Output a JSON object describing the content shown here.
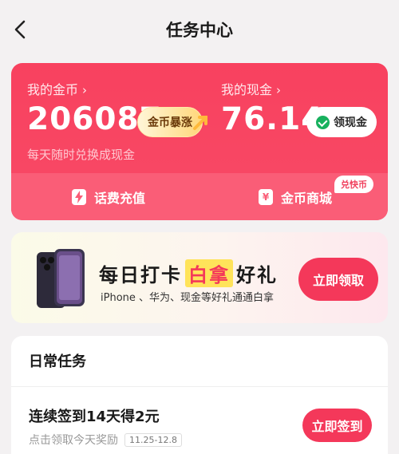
{
  "header": {
    "title": "任务中心"
  },
  "wallet": {
    "coins_label": "我的金币",
    "coins_value": "206087",
    "surge_label": "金币暴涨",
    "cash_label": "我的现金",
    "cash_value": "76.14",
    "claim_cash_label": "领现金",
    "subtitle": "每天随时兑换成现金",
    "phone_topup_label": "话费充值",
    "coin_mall_label": "金币商城",
    "fast_redeem_badge": "兑快币"
  },
  "banner": {
    "title_part1": "每日打卡",
    "title_highlight": "白拿",
    "title_part2": "好礼",
    "subtitle": "iPhone 、华为、现金等好礼通通白拿",
    "button_label": "立即领取"
  },
  "daily_tasks": {
    "section_title": "日常任务",
    "items": [
      {
        "name": "连续签到14天得2元",
        "desc": "点击领取今天奖励",
        "date_range": "11.25-12.8",
        "button_label": "立即签到"
      }
    ]
  },
  "colors": {
    "accent": "#f4385a",
    "wallet_bg": "#f7415f",
    "page_bg": "#f3f1f2"
  }
}
